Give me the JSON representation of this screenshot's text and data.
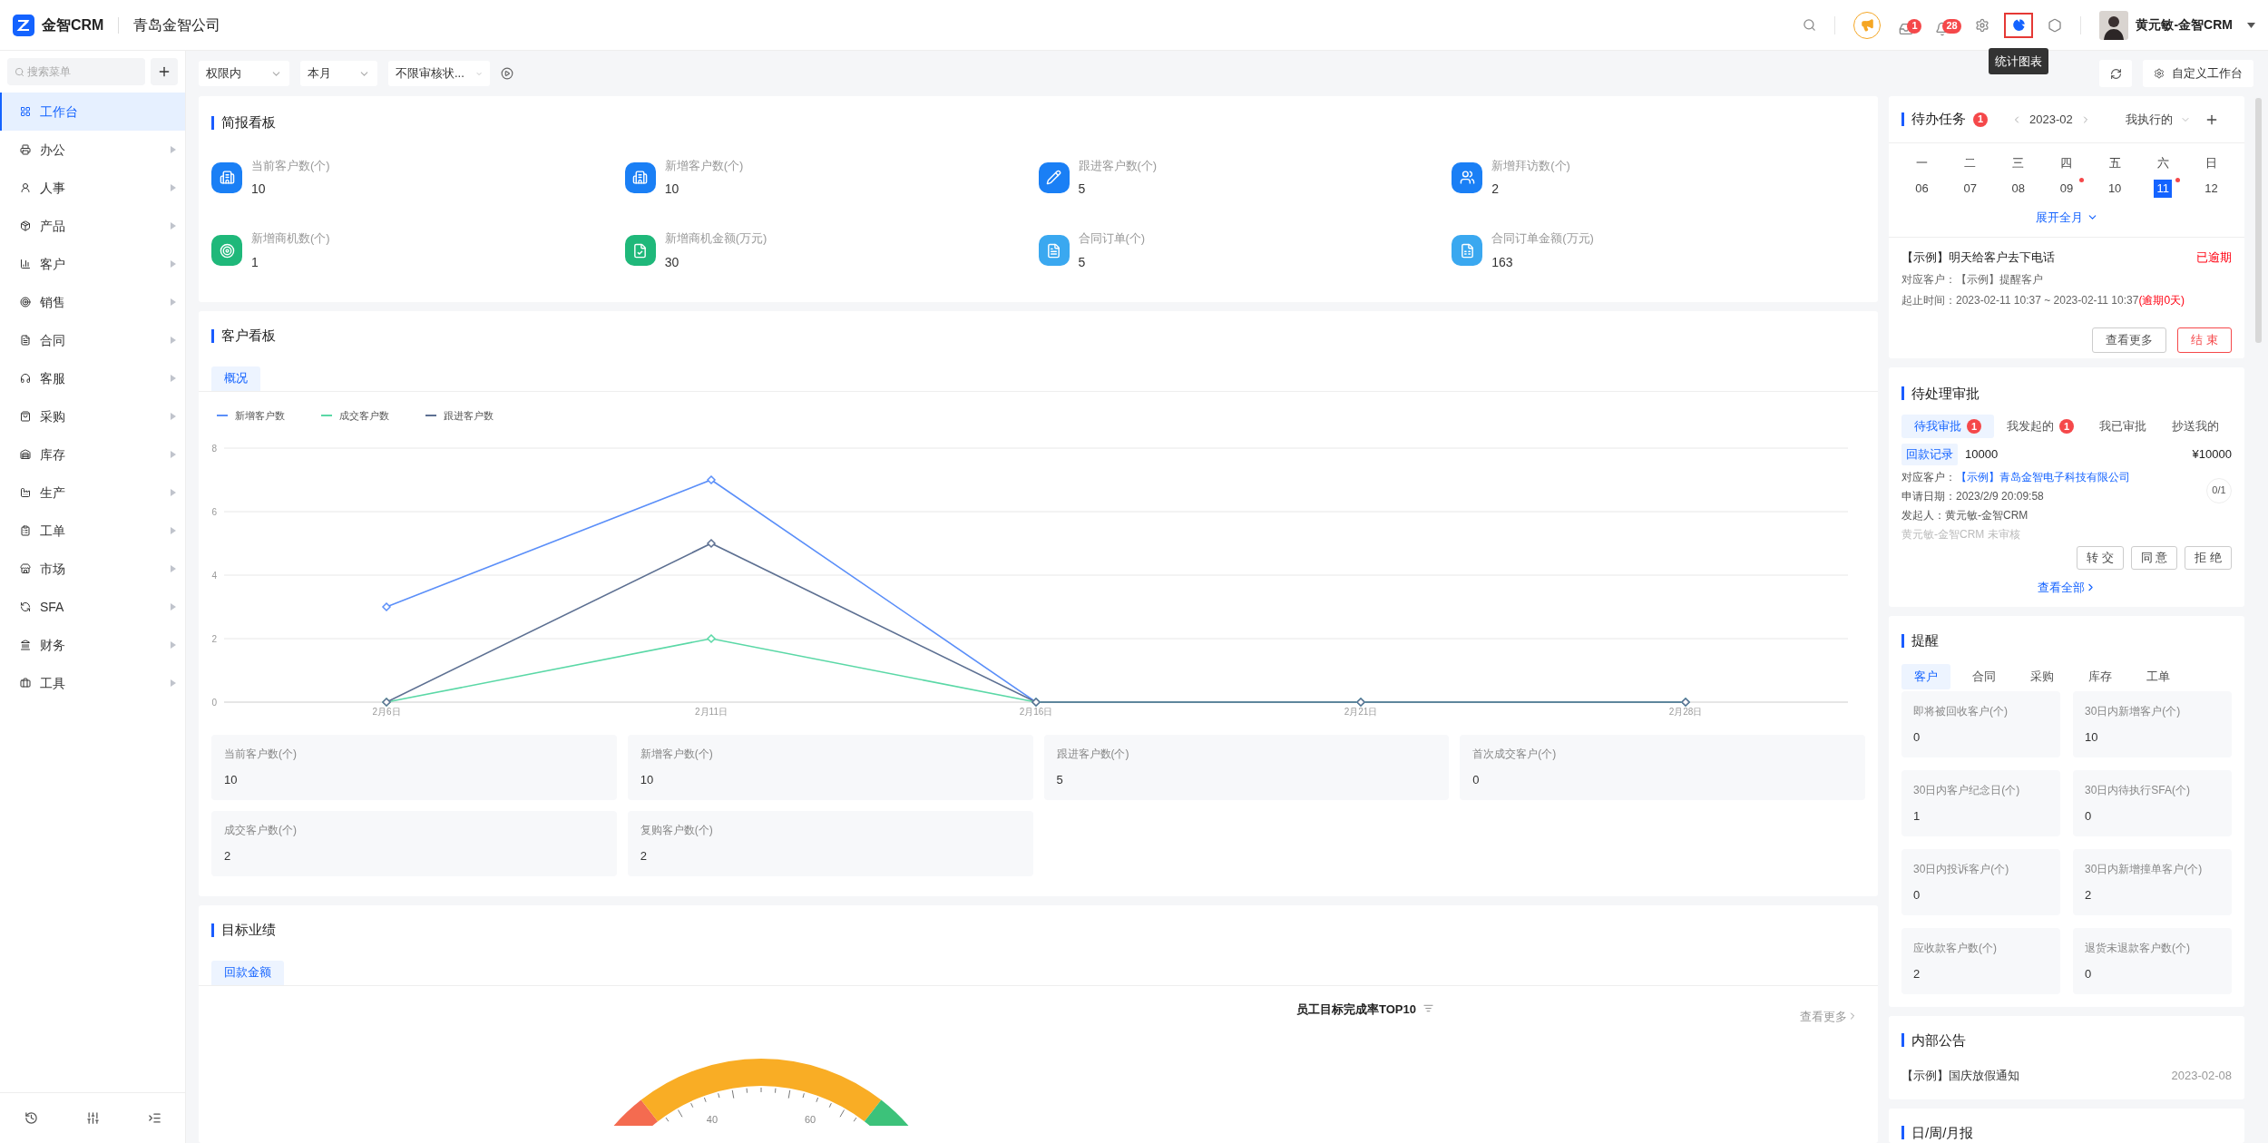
{
  "header": {
    "brand": "金智CRM",
    "company": "青岛金智公司",
    "badges": [
      "1",
      "28"
    ],
    "tooltip": "统计图表",
    "user": "黄元敏-金智CRM"
  },
  "sidebar": {
    "search_placeholder": "搜索菜单",
    "items": [
      {
        "label": "工作台",
        "selected": true
      },
      {
        "label": "办公",
        "selected": false
      },
      {
        "label": "人事",
        "selected": false
      },
      {
        "label": "产品",
        "selected": false
      },
      {
        "label": "客户",
        "selected": false
      },
      {
        "label": "销售",
        "selected": false
      },
      {
        "label": "合同",
        "selected": false
      },
      {
        "label": "客服",
        "selected": false
      },
      {
        "label": "采购",
        "selected": false
      },
      {
        "label": "库存",
        "selected": false
      },
      {
        "label": "生产",
        "selected": false
      },
      {
        "label": "工单",
        "selected": false
      },
      {
        "label": "市场",
        "selected": false
      },
      {
        "label": "SFA",
        "selected": false
      },
      {
        "label": "财务",
        "selected": false
      },
      {
        "label": "工具",
        "selected": false
      }
    ]
  },
  "toolbar": {
    "filters": [
      "权限内",
      "本月",
      "不限审核状..."
    ],
    "customize": "自定义工作台"
  },
  "briefing": {
    "title": "简报看板",
    "metrics": [
      {
        "label": "当前客户数(个)",
        "value": "10",
        "color": "#1a7ff5"
      },
      {
        "label": "新增客户数(个)",
        "value": "10",
        "color": "#1a7ff5"
      },
      {
        "label": "跟进客户数(个)",
        "value": "5",
        "color": "#1a7ff5"
      },
      {
        "label": "新增拜访数(个)",
        "value": "2",
        "color": "#1a7ff5"
      },
      {
        "label": "新增商机数(个)",
        "value": "1",
        "color": "#1fb87a"
      },
      {
        "label": "新增商机金额(万元)",
        "value": "30",
        "color": "#1fb87a"
      },
      {
        "label": "合同订单(个)",
        "value": "5",
        "color": "#3aa8f0"
      },
      {
        "label": "合同订单金额(万元)",
        "value": "163",
        "color": "#3aa8f0"
      }
    ]
  },
  "customer_board": {
    "title": "客户看板",
    "tabs": [
      {
        "label": "概况",
        "selected": true
      }
    ],
    "chart_data": {
      "type": "line",
      "grid": true,
      "legend": true,
      "categories": [
        "2月6日",
        "2月11日",
        "2月16日",
        "2月21日",
        "2月28日"
      ],
      "ylim": [
        0,
        8
      ],
      "yticks": [
        0,
        2,
        4,
        6,
        8
      ],
      "series": [
        {
          "name": "新增客户数",
          "color": "#5b8ff9",
          "marker": "diamond",
          "values": [
            3,
            7,
            0,
            0,
            0
          ]
        },
        {
          "name": "成交客户数",
          "color": "#5ad8a6",
          "marker": "diamond",
          "values": [
            0,
            2,
            0,
            0,
            0
          ]
        },
        {
          "name": "跟进客户数",
          "color": "#5d7092",
          "marker": "diamond",
          "values": [
            0,
            5,
            0,
            0,
            0
          ]
        }
      ]
    },
    "stats": [
      {
        "label": "当前客户数(个)",
        "value": "10"
      },
      {
        "label": "新增客户数(个)",
        "value": "10"
      },
      {
        "label": "跟进客户数(个)",
        "value": "5"
      },
      {
        "label": "首次成交客户(个)",
        "value": "0"
      },
      {
        "label": "成交客户数(个)",
        "value": "2"
      },
      {
        "label": "复购客户数(个)",
        "value": "2"
      }
    ]
  },
  "targets": {
    "title": "目标业绩",
    "tabs": [
      {
        "label": "回款金额",
        "selected": true
      }
    ],
    "gauge_labels": [
      "40",
      "60"
    ],
    "ranking_title": "员工目标完成率TOP10",
    "more": "查看更多"
  },
  "tasks": {
    "title": "待办任务",
    "badge": "1",
    "month": "2023-02",
    "filter": "我执行的",
    "weekdays": [
      "一",
      "二",
      "三",
      "四",
      "五",
      "六",
      "日"
    ],
    "dates": [
      {
        "label": "06",
        "selected": false,
        "has_task": false
      },
      {
        "label": "07",
        "selected": false,
        "has_task": false
      },
      {
        "label": "08",
        "selected": false,
        "has_task": false
      },
      {
        "label": "09",
        "selected": false,
        "has_task": true
      },
      {
        "label": "10",
        "selected": false,
        "has_task": false
      },
      {
        "label": "11",
        "selected": true,
        "has_task": true
      },
      {
        "label": "12",
        "selected": false,
        "has_task": false
      }
    ],
    "expand": "展开全月",
    "item": {
      "title": "【示例】明天给客户去下电话",
      "status": "已逾期",
      "customer_label": "对应客户：",
      "customer": "【示例】提醒客户",
      "time_label": "起止时间：",
      "time": "2023-02-11 10:37 ~ 2023-02-11 10:37",
      "overdue": "(逾期0天)"
    },
    "buttons": [
      "查看更多",
      "结 束"
    ]
  },
  "approvals": {
    "title": "待处理审批",
    "tabs": [
      {
        "label": "待我审批",
        "badge": "1",
        "selected": true
      },
      {
        "label": "我发起的",
        "badge": "1",
        "selected": false
      },
      {
        "label": "我已审批",
        "selected": false
      },
      {
        "label": "抄送我的",
        "selected": false
      }
    ],
    "item": {
      "tag": "回款记录",
      "number": "10000",
      "amount": "¥10000",
      "customer_label": "对应客户：",
      "customer": "【示例】青岛金智电子科技有限公司",
      "date": "申请日期：2023/2/9 20:09:58",
      "initiator": "发起人：黄元敏-金智CRM",
      "status": "黄元敏-金智CRM 未审核",
      "progress": "0/1"
    },
    "buttons": [
      "转 交",
      "同 意",
      "拒 绝"
    ],
    "view_all": "查看全部"
  },
  "reminders": {
    "title": "提醒",
    "tabs": [
      {
        "label": "客户",
        "selected": true
      },
      {
        "label": "合同",
        "selected": false
      },
      {
        "label": "采购",
        "selected": false
      },
      {
        "label": "库存",
        "selected": false
      },
      {
        "label": "工单",
        "selected": false
      }
    ],
    "stats": [
      {
        "label": "即将被回收客户(个)",
        "value": "0"
      },
      {
        "label": "30日内新增客户(个)",
        "value": "10"
      },
      {
        "label": "30日内客户纪念日(个)",
        "value": "1"
      },
      {
        "label": "30日内待执行SFA(个)",
        "value": "0"
      },
      {
        "label": "30日内投诉客户(个)",
        "value": "0"
      },
      {
        "label": "30日内新增撞单客户(个)",
        "value": "2"
      },
      {
        "label": "应收款客户数(个)",
        "value": "2"
      },
      {
        "label": "退货未退款客户数(个)",
        "value": "0"
      }
    ]
  },
  "notices": {
    "title": "内部公告",
    "items": [
      {
        "title": "【示例】国庆放假通知",
        "date": "2023-02-08"
      }
    ]
  },
  "reports": {
    "title": "日/周/月报"
  }
}
